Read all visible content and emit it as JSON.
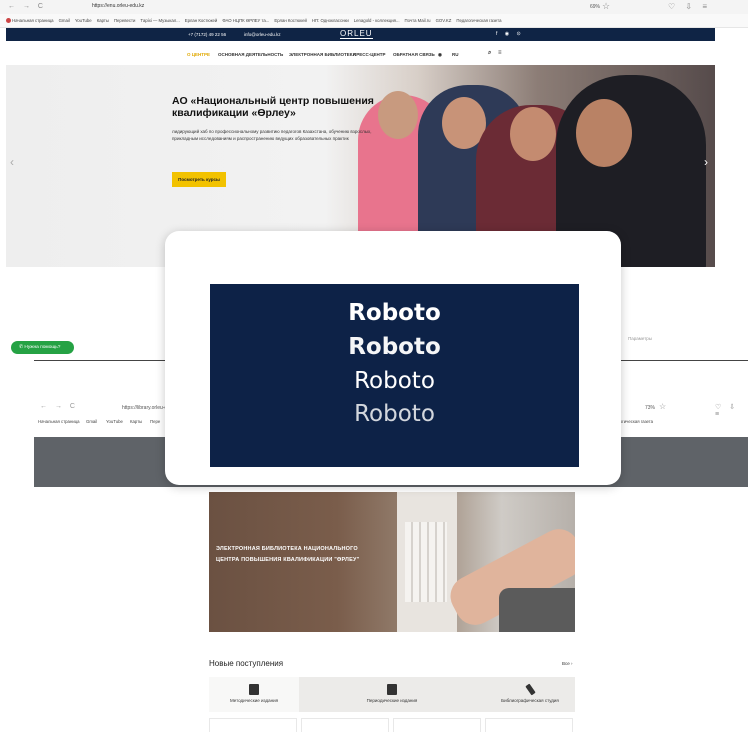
{
  "browser_top": {
    "url": "https://enu.orleu-edu.kz",
    "zoom": "69%",
    "bookmarks": [
      "Начальная страница",
      "Gmail",
      "YouTube",
      "Карты",
      "Перевести",
      "Tаріхі — Музыкал...",
      "Ерлан Костюкей",
      "ФАО НЦПК ӨРЛЕУ та...",
      "Ерлан Костюкей",
      "НП: Однокласснки",
      "Lenagold - коллекция...",
      "Почта Mail.ru",
      "GOV.KZ",
      "Педагогическая газета"
    ]
  },
  "site": {
    "phone": "+7 (7172) 49 22 56",
    "email": "info@orleu-edu.kz",
    "logo": "ORLEU",
    "social": "f ◉ ⊙",
    "nav": [
      "О ЦЕНТРЕ",
      "ОСНОВНАЯ ДЕЯТЕЛЬНОСТЬ",
      "ЭЛЕКТРОННАЯ БИБЛИОТЕКА",
      "ПРЕСС-ЦЕНТР",
      "ОБРАТНАЯ СВЯЗЬ",
      "RU"
    ],
    "hero_title": "АО «Национальный центр повышения квалификации «Өрлеу»",
    "hero_text": "лидирующий хаб по профессиональному развитию педагогов Казахстана, обучению взрослых, прикладным исследованиям и распространению ведущих образовательных практик",
    "hero_button": "Посмотреть курсы",
    "help_button": "Нужна помощь?",
    "cookie_hint": "Параметры"
  },
  "browser_bottom": {
    "url": "https://library.orleu-edu.kz",
    "zoom": "73%",
    "bookmarks": [
      "Начальная страница",
      "Gmail",
      "YouTube",
      "Карты",
      "Пере",
      "Педагогическая газета"
    ]
  },
  "library": {
    "hero_title": "ЭЛЕКТРОННАЯ БИБЛИОТЕКА НАЦИОНАЛЬНОГО ЦЕНТРА ПОВЫШЕНИЯ КВАЛИФИКАЦИИ \"ӨРЛЕУ\"",
    "new_arrivals": "Новые поступления",
    "all_link": "Все ›",
    "categories": [
      "Методические издания",
      "Периодические издания",
      "Библиографическая студия"
    ]
  },
  "font_sample": {
    "label": "Roboto",
    "weights": [
      "Roboto",
      "Roboto",
      "Roboto",
      "Roboto"
    ],
    "panel_color": "#0d2247"
  }
}
